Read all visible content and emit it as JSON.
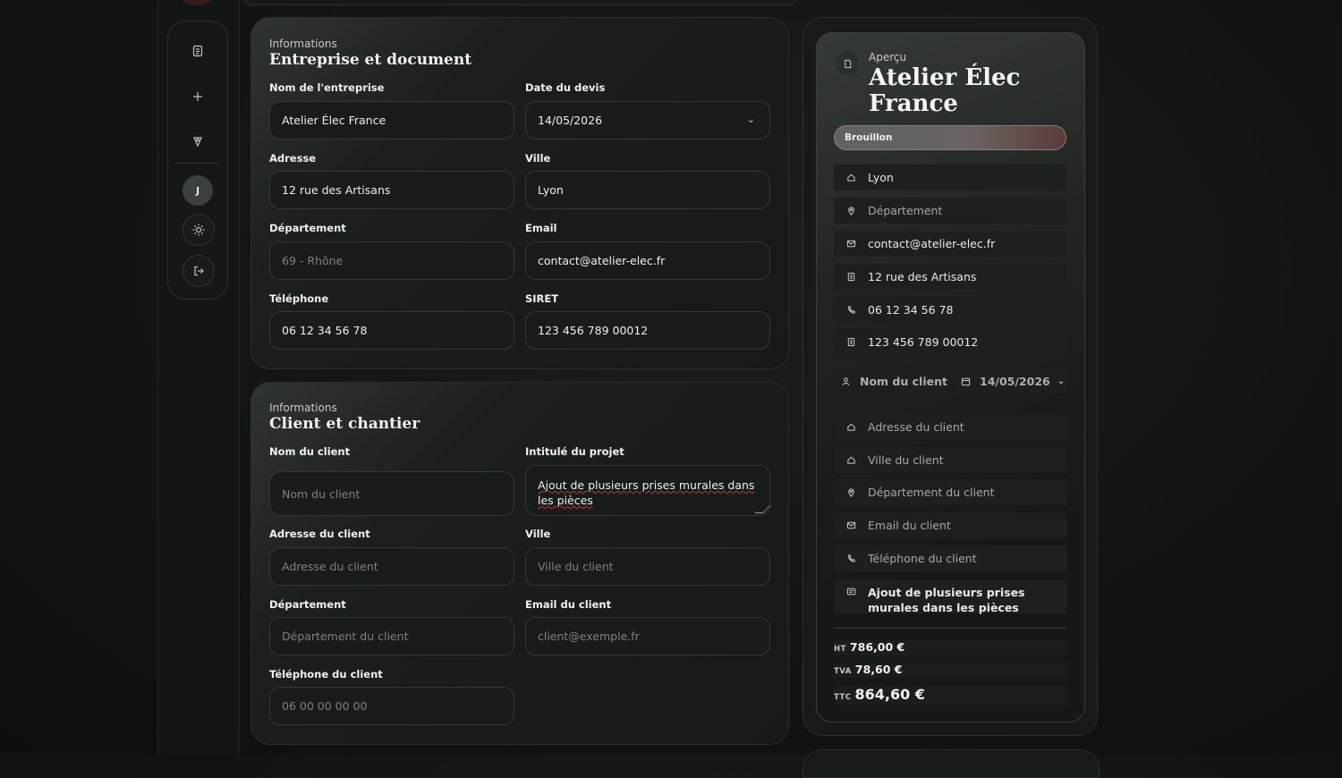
{
  "sidebar": {
    "avatar_initial": "J",
    "icons": [
      "document-icon",
      "plus-icon",
      "pin-icon",
      "sun-icon",
      "logout-icon"
    ]
  },
  "company": {
    "kicker": "Informations",
    "title": "Entreprise et document",
    "fields": {
      "name": {
        "label": "Nom de l'entreprise",
        "value": "Atelier Élec France"
      },
      "date": {
        "label": "Date du devis",
        "value": "14/05/2026"
      },
      "address": {
        "label": "Adresse",
        "value": "12 rue des Artisans"
      },
      "city": {
        "label": "Ville",
        "value": "Lyon"
      },
      "department": {
        "label": "Département",
        "placeholder": "69 - Rhône"
      },
      "email": {
        "label": "Email",
        "value": "contact@atelier-elec.fr"
      },
      "phone": {
        "label": "Téléphone",
        "value": "06 12 34 56 78"
      },
      "siret": {
        "label": "SIRET",
        "value": "123 456 789 00012"
      }
    }
  },
  "client": {
    "kicker": "Informations",
    "title": "Client et chantier",
    "fields": {
      "name": {
        "label": "Nom du client",
        "placeholder": "Nom du client"
      },
      "project": {
        "label": "Intitulé du projet",
        "value": "Ajout de plusieurs prises murales dans les pièces"
      },
      "address": {
        "label": "Adresse du client",
        "placeholder": "Adresse du client"
      },
      "city": {
        "label": "Ville",
        "placeholder": "Ville du client"
      },
      "department": {
        "label": "Département",
        "placeholder": "Département du client"
      },
      "email": {
        "label": "Email du client",
        "placeholder": "client@exemple.fr"
      },
      "phone": {
        "label": "Téléphone du client",
        "placeholder": "06 00 00 00 00"
      }
    }
  },
  "preview": {
    "kicker": "Aperçu",
    "title": "Atelier Élec France",
    "status": "Brouillon",
    "company_rows": {
      "city": "Lyon",
      "department": "Département",
      "email": "contact@atelier-elec.fr",
      "address": "12 rue des Artisans",
      "phone": "06 12 34 56 78",
      "siret": "123 456 789 00012"
    },
    "client_chip": "Nom du client",
    "date_chip": "14/05/2026",
    "client_rows": {
      "address": "Adresse du client",
      "city": "Ville du client",
      "department": "Département du client",
      "email": "Email du client",
      "phone": "Téléphone du client",
      "project": "Ajout de plusieurs prises murales dans les pièces"
    },
    "totals": {
      "ht_label": "HT",
      "ht": "786,00 €",
      "tva_label": "TVA",
      "tva": "78,60 €",
      "ttc_label": "TTC",
      "ttc": "864,60 €"
    }
  },
  "colors": {
    "background": "#111513",
    "panel": "#181c1a",
    "status_badge": "#6a6260"
  }
}
